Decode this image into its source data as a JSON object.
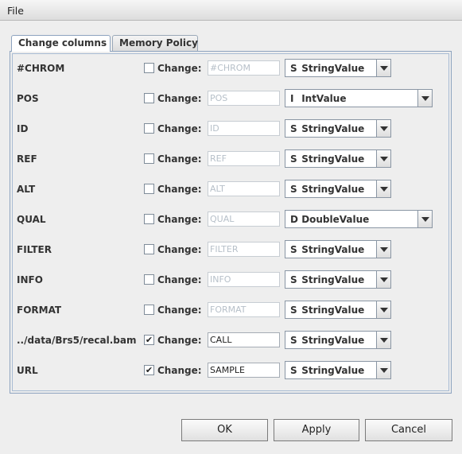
{
  "menubar": {
    "file": "File"
  },
  "tabs": [
    {
      "label": "Change columns"
    },
    {
      "label": "Memory Policy"
    }
  ],
  "change_label": "Change:",
  "rows": [
    {
      "name": "#CHROM",
      "checked": false,
      "value": "#CHROM",
      "type_icon": "S",
      "type": "StringValue"
    },
    {
      "name": "POS",
      "checked": false,
      "value": "POS",
      "type_icon": "I",
      "type": "IntValue"
    },
    {
      "name": "ID",
      "checked": false,
      "value": "ID",
      "type_icon": "S",
      "type": "StringValue"
    },
    {
      "name": "REF",
      "checked": false,
      "value": "REF",
      "type_icon": "S",
      "type": "StringValue"
    },
    {
      "name": "ALT",
      "checked": false,
      "value": "ALT",
      "type_icon": "S",
      "type": "StringValue"
    },
    {
      "name": "QUAL",
      "checked": false,
      "value": "QUAL",
      "type_icon": "D",
      "type": "DoubleValue"
    },
    {
      "name": "FILTER",
      "checked": false,
      "value": "FILTER",
      "type_icon": "S",
      "type": "StringValue"
    },
    {
      "name": "INFO",
      "checked": false,
      "value": "INFO",
      "type_icon": "S",
      "type": "StringValue"
    },
    {
      "name": "FORMAT",
      "checked": false,
      "value": "FORMAT",
      "type_icon": "S",
      "type": "StringValue"
    },
    {
      "name": "../data/Brs5/recal.bam",
      "checked": true,
      "value": "CALL",
      "type_icon": "S",
      "type": "StringValue"
    },
    {
      "name": "URL",
      "checked": true,
      "value": "SAMPLE",
      "type_icon": "S",
      "type": "StringValue"
    }
  ],
  "buttons": {
    "ok": "OK",
    "apply": "Apply",
    "cancel": "Cancel"
  }
}
